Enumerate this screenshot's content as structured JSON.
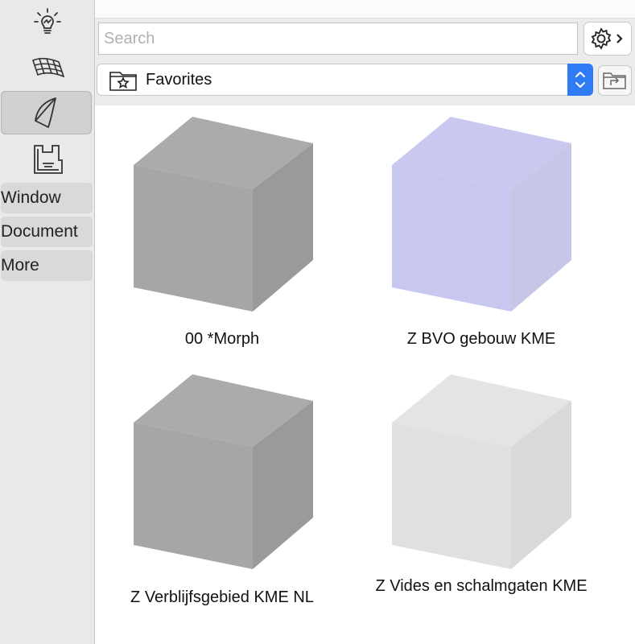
{
  "sidebar": {
    "tools": [
      {
        "icon": "lightbulb-icon",
        "selected": false
      },
      {
        "icon": "mesh-icon",
        "selected": false
      },
      {
        "icon": "shell-icon",
        "selected": true
      },
      {
        "icon": "floor-plan-icon",
        "selected": false
      }
    ],
    "buttons": [
      {
        "label": "Window"
      },
      {
        "label": "Document"
      },
      {
        "label": "More"
      }
    ]
  },
  "toolbar": {
    "search_placeholder": "Search",
    "folder_label": "Favorites"
  },
  "items": [
    {
      "label": "00 *Morph",
      "color": "gray"
    },
    {
      "label": "Z BVO gebouw KME",
      "color": "lavender"
    },
    {
      "label": "Z Verblijfsgebied KME NL",
      "color": "gray"
    },
    {
      "label": "Z Vides en schalmgaten KME",
      "color": "light-gray"
    }
  ],
  "colors": {
    "accent": "#2f7bf5",
    "sidebar_bg": "#e9e9e9",
    "cube_gray": "#a8a8a8",
    "cube_lavender": "#c8c8ee",
    "cube_light": "#e2e2e2"
  }
}
